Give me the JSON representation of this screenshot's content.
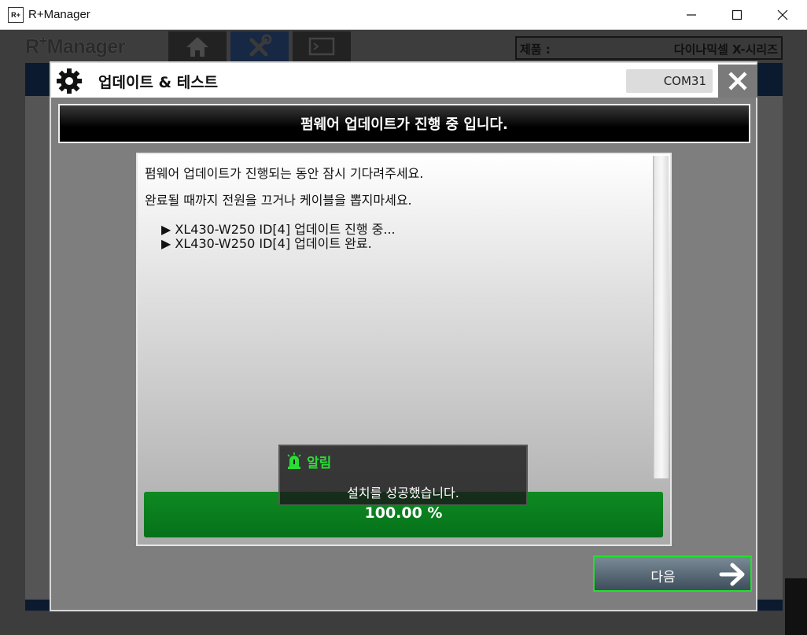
{
  "window": {
    "icon_text": "R+",
    "title": "R+Manager"
  },
  "app": {
    "brand": "R",
    "brand_plus": "+",
    "brand_rest": "Manager",
    "nav_tabs": [
      "home",
      "tools",
      "terminal"
    ],
    "product_label": "제품 :",
    "product_value": "다이나믹셀 X-시리즈"
  },
  "dialog": {
    "title": "업데이트 & 테스트",
    "com_port": "COM31",
    "status": "펌웨어 업데이트가 진행 중 입니다.",
    "log": {
      "line1": "펌웨어 업데이트가 진행되는 동안 잠시 기다려주세요.",
      "line2": "완료될 때까지 전원을 끄거나 케이블을 뽑지마세요.",
      "entry1": "▶ XL430-W250  ID[4] 업데이트 진행 중...",
      "entry2": "▶ XL430-W250  ID[4] 업데이트 완료."
    },
    "progress": {
      "value": 100,
      "text": "100.00 %"
    },
    "toast": {
      "title": "알림",
      "message": "설치를 성공했습니다."
    },
    "next_label": "다음"
  },
  "colors": {
    "accent_green": "#22e02c",
    "progress_green": "#0b7a1e",
    "nav_active": "#172844"
  }
}
